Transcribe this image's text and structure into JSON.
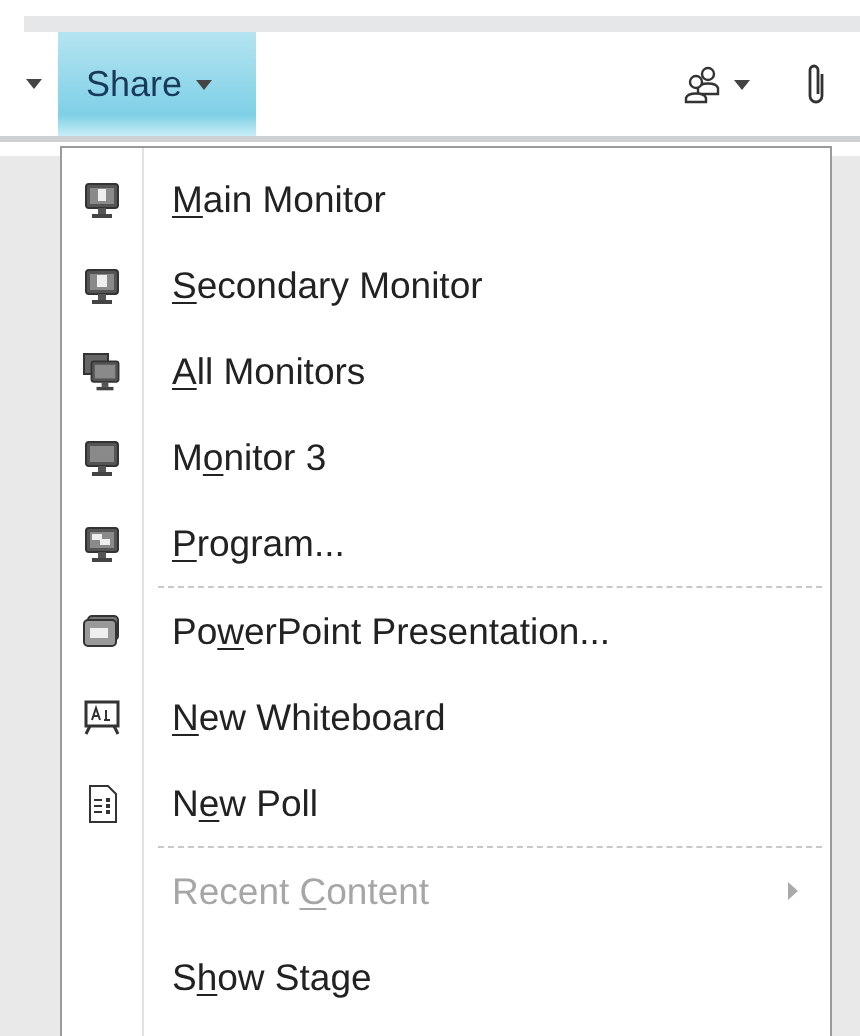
{
  "toolbar": {
    "share_button": {
      "label": "Share",
      "selected": true
    }
  },
  "share_menu": {
    "items": [
      {
        "kind": "item",
        "access_key": "M",
        "label_after": "ain Monitor",
        "disabled": false,
        "submenu": false
      },
      {
        "kind": "item",
        "access_key": "S",
        "label_after": "econdary Monitor",
        "disabled": false,
        "submenu": false
      },
      {
        "kind": "item",
        "access_key": "A",
        "label_after": "ll Monitors",
        "disabled": false,
        "submenu": false
      },
      {
        "kind": "item",
        "label_before": "M",
        "access_key": "o",
        "label_after": "nitor 3",
        "disabled": false,
        "submenu": false
      },
      {
        "kind": "item",
        "access_key": "P",
        "label_after": "rogram...",
        "disabled": false,
        "submenu": false
      },
      {
        "kind": "separator"
      },
      {
        "kind": "item",
        "label_before": "Po",
        "access_key": "w",
        "label_after": "erPoint Presentation...",
        "disabled": false,
        "submenu": false
      },
      {
        "kind": "item",
        "access_key": "N",
        "label_after": "ew Whiteboard",
        "disabled": false,
        "submenu": false
      },
      {
        "kind": "item",
        "label_before": "N",
        "access_key": "e",
        "label_after": "w Poll",
        "disabled": false,
        "submenu": false
      },
      {
        "kind": "separator"
      },
      {
        "kind": "item",
        "label_before": "Recent ",
        "access_key": "C",
        "label_after": "ontent",
        "disabled": true,
        "submenu": true
      },
      {
        "kind": "item",
        "label_before": "S",
        "access_key": "h",
        "label_after": "ow Stage",
        "disabled": false,
        "submenu": false
      }
    ]
  }
}
